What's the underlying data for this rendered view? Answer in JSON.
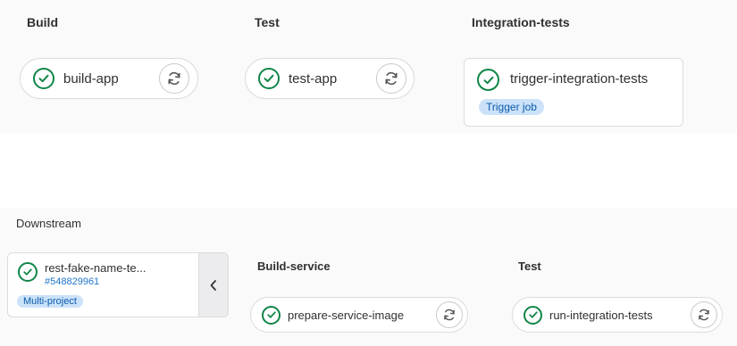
{
  "stages_top": [
    {
      "title": "Build",
      "job": {
        "name": "build-app",
        "status": "success",
        "action_icon": "retry-icon"
      }
    },
    {
      "title": "Test",
      "job": {
        "name": "test-app",
        "status": "success",
        "action_icon": "retry-icon"
      }
    },
    {
      "title": "Integration-tests",
      "job": {
        "name": "trigger-integration-tests",
        "status": "success",
        "badge": "Trigger job"
      }
    }
  ],
  "downstream": {
    "heading": "Downstream",
    "pipeline": {
      "name": "rest-fake-name-te...",
      "id": "#548829961",
      "status": "success",
      "badge": "Multi-project",
      "collapse_icon": "chevron-left-icon"
    },
    "stages": [
      {
        "title": "Build-service",
        "job": {
          "name": "prepare-service-image",
          "status": "success",
          "action_icon": "retry-icon"
        }
      },
      {
        "title": "Test",
        "job": {
          "name": "run-integration-tests",
          "status": "success",
          "action_icon": "retry-icon"
        }
      }
    ]
  },
  "colors": {
    "success": "#108548",
    "badge_bg": "#cbe2f9",
    "badge_text": "#0b5cad",
    "link": "#1f75cb"
  }
}
